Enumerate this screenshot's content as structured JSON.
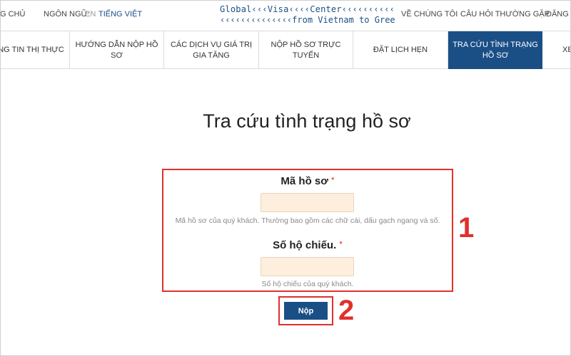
{
  "topbar": {
    "home": "G CHỦ",
    "language_label": "NGÔN NGỮ:",
    "lang_en": "EN",
    "lang_vi": "TIẾNG VIỆT",
    "about": "VỀ CHÚNG TÔI",
    "faq": "CÂU HỎI THƯỜNG GẶP",
    "register": "ĐĂNG K"
  },
  "logo": {
    "line1": "Global‹‹‹Visa‹‹‹‹Center‹‹‹‹‹‹‹‹‹‹‹‹‹‹‹‹",
    "line2": "‹‹‹‹‹‹‹‹‹‹‹‹‹‹from Vietnam to Greece"
  },
  "nav": {
    "items": [
      {
        "label": "NG TIN THỊ THỰC"
      },
      {
        "label": "HƯỚNG DẪN NỘP HỒ SƠ"
      },
      {
        "label": "CÁC DỊCH VỤ GIÁ TRỊ GIA TĂNG"
      },
      {
        "label": "NỘP HỒ SƠ TRỰC TUYẾN"
      },
      {
        "label": "ĐẶT LỊCH HẸN"
      },
      {
        "label": "TRA CỨU TÌNH TRẠNG HỒ SƠ"
      },
      {
        "label": "XE"
      }
    ]
  },
  "main": {
    "title": "Tra cứu tình trạng hồ sơ",
    "application_code": {
      "label": "Mã hồ sơ",
      "required": "*",
      "value": "",
      "hint": "Mã hồ sơ của quý khách. Thường bao gồm các chữ cái, dấu gạch ngang và số."
    },
    "passport": {
      "label": "Số hộ chiếu.",
      "required": "*",
      "value": "",
      "hint": "Số hộ chiếu của quý khách."
    },
    "submit_label": "Nộp"
  },
  "annotations": {
    "marker_1": "1",
    "marker_2": "2"
  },
  "colors": {
    "accent": "#1a4f86",
    "annotation_red": "#e0302c",
    "input_bg": "#fdeedd"
  }
}
